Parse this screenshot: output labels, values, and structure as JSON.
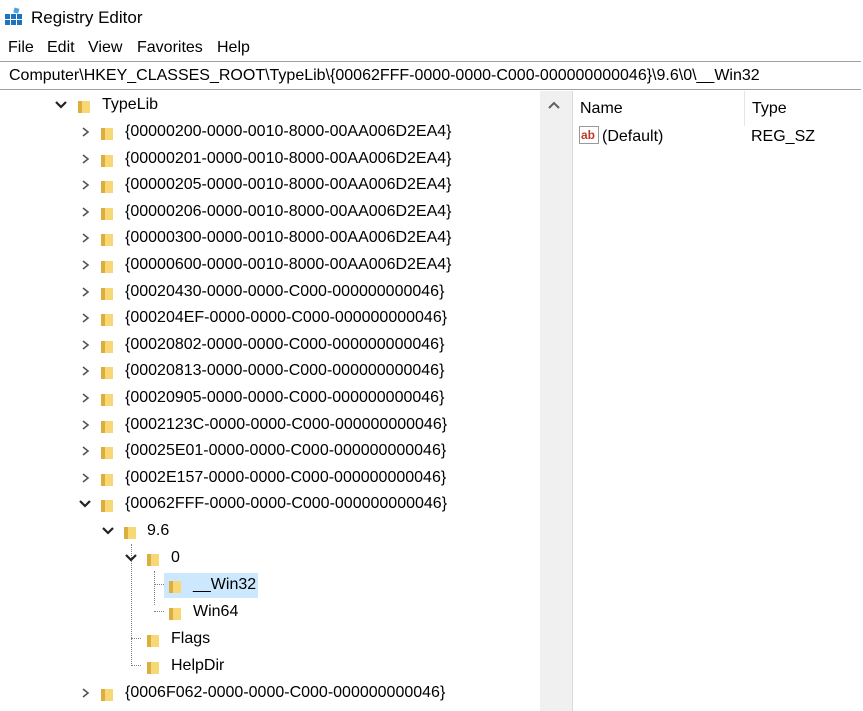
{
  "window": {
    "title": "Registry Editor"
  },
  "menu": [
    "File",
    "Edit",
    "View",
    "Favorites",
    "Help"
  ],
  "address": "Computer\\HKEY_CLASSES_ROOT\\TypeLib\\{00062FFF-0000-0000-C000-000000000046}\\9.6\\0\\__Win32",
  "tree": {
    "typelib": "TypeLib",
    "keys": [
      "{00000200-0000-0010-8000-00AA006D2EA4}",
      "{00000201-0000-0010-8000-00AA006D2EA4}",
      "{00000205-0000-0010-8000-00AA006D2EA4}",
      "{00000206-0000-0010-8000-00AA006D2EA4}",
      "{00000300-0000-0010-8000-00AA006D2EA4}",
      "{00000600-0000-0010-8000-00AA006D2EA4}",
      "{00020430-0000-0000-C000-000000000046}",
      "{000204EF-0000-0000-C000-000000000046}",
      "{00020802-0000-0000-C000-000000000046}",
      "{00020813-0000-0000-C000-000000000046}",
      "{00020905-0000-0000-C000-000000000046}",
      "{0002123C-0000-0000-C000-000000000046}",
      "{00025E01-0000-0000-C000-000000000046}",
      "{0002E157-0000-0000-C000-000000000046}"
    ],
    "expanded_key": "{00062FFF-0000-0000-C000-000000000046}",
    "version": "9.6",
    "lcid": "0",
    "win32": "__Win32",
    "win64": "Win64",
    "flags": "Flags",
    "helpdir": "HelpDir",
    "next_key": "{0006F062-0000-0000-C000-000000000046}"
  },
  "list": {
    "headers": {
      "name": "Name",
      "type": "Type"
    },
    "rows": [
      {
        "name": "(Default)",
        "type": "REG_SZ"
      }
    ]
  },
  "colors": {
    "selected": "#cce8ff",
    "folder": "#f8d775",
    "folder_dark": "#dcae3f",
    "icon_blue": "#1e73be"
  }
}
